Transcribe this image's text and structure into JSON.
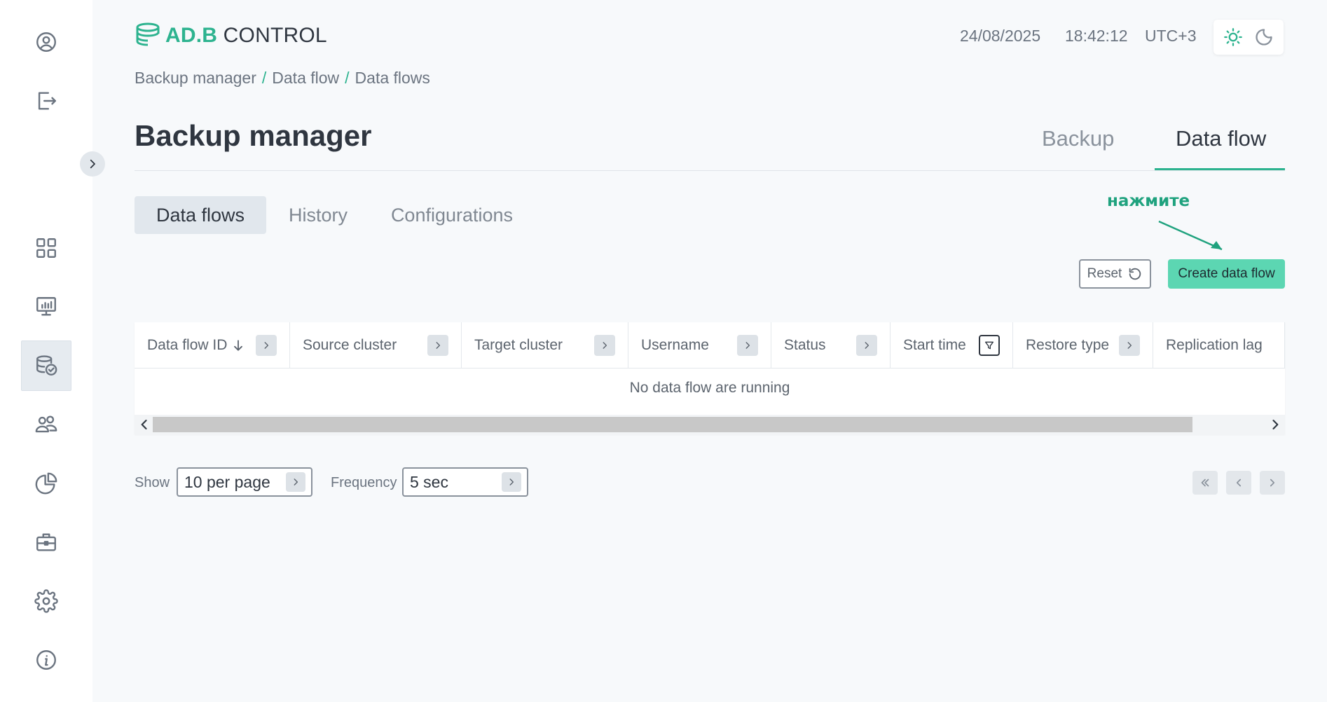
{
  "header": {
    "logo_adb": "AD.B",
    "logo_control": " CONTROL",
    "date": "24/08/2025",
    "time": "18:42:12",
    "timezone": "UTC+3"
  },
  "breadcrumb": [
    "Backup manager",
    "Data flow",
    "Data flows"
  ],
  "page_title": "Backup manager",
  "top_tabs": [
    {
      "label": "Backup",
      "active": false
    },
    {
      "label": "Data flow",
      "active": true
    }
  ],
  "sub_tabs": [
    {
      "label": "Data flows",
      "active": true
    },
    {
      "label": "History",
      "active": false
    },
    {
      "label": "Configurations",
      "active": false
    }
  ],
  "annotation": "нажмите",
  "actions": {
    "reset_label": "Reset",
    "create_label": "Create data flow"
  },
  "table": {
    "columns": [
      {
        "label": "Data flow ID",
        "control": "expand",
        "sorted": "desc"
      },
      {
        "label": "Source cluster",
        "control": "expand"
      },
      {
        "label": "Target cluster",
        "control": "expand"
      },
      {
        "label": "Username",
        "control": "expand"
      },
      {
        "label": "Status",
        "control": "expand"
      },
      {
        "label": "Start time",
        "control": "filter"
      },
      {
        "label": "Restore type",
        "control": "expand"
      },
      {
        "label": "Replication lag",
        "control": "none"
      }
    ],
    "empty_text": "No data flow are running"
  },
  "footer": {
    "show_label": "Show",
    "show_value": "10 per page",
    "frequency_label": "Frequency",
    "frequency_value": "5 sec"
  },
  "sidebar": {
    "items": [
      {
        "icon": "user-circle-icon"
      },
      {
        "icon": "logout-icon"
      },
      {
        "icon": "dashboard-grid-icon"
      },
      {
        "icon": "monitoring-icon"
      },
      {
        "icon": "database-backup-icon",
        "active": true
      },
      {
        "icon": "users-icon"
      },
      {
        "icon": "pie-chart-icon"
      },
      {
        "icon": "briefcase-icon"
      },
      {
        "icon": "gear-icon"
      },
      {
        "icon": "info-icon"
      }
    ]
  },
  "colors": {
    "accent": "#2db38f",
    "button_primary": "#5cd6b2",
    "text_dark": "#2f3640",
    "text_muted": "#6b7480",
    "background": "#f7f9fb"
  }
}
